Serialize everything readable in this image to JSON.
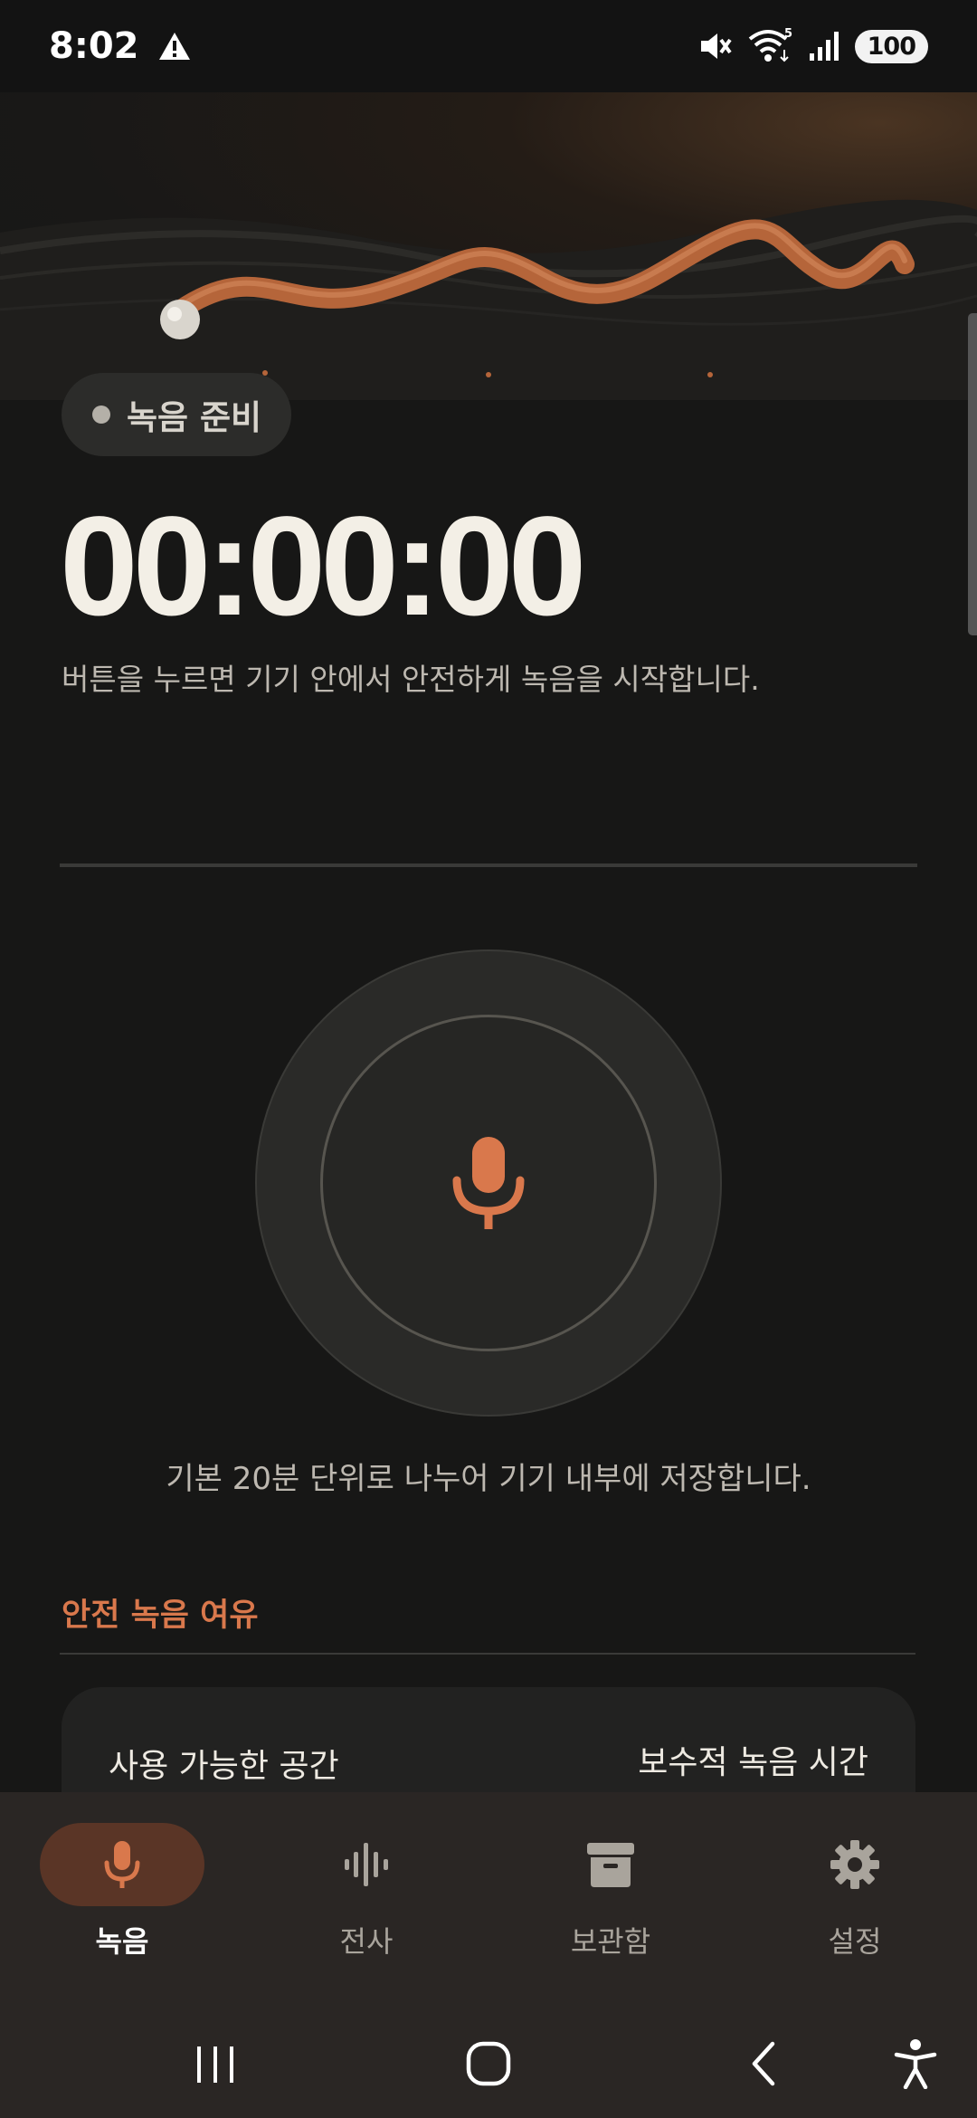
{
  "status_bar": {
    "time": "8:02",
    "battery": "100",
    "icons": [
      "alert-triangle-icon",
      "mute-icon",
      "wifi-icon",
      "signal-icon"
    ],
    "wifi_badge": "5"
  },
  "recorder": {
    "status_chip": "녹음 준비",
    "timer": "00:00:00",
    "subtitle": "버튼을 누르면 기기 안에서 안전하게 녹음을 시작합니다.",
    "caption": "기본 20분 단위로 나누어 기기 내부에 저장합니다."
  },
  "safety": {
    "section_title": "안전 녹음 여유",
    "available_space_label": "사용 가능한 공간",
    "conservative_time_label": "보수적 녹음 시간"
  },
  "nav": {
    "items": [
      {
        "label": "녹음",
        "icon": "microphone-icon",
        "active": true
      },
      {
        "label": "전사",
        "icon": "waveform-icon",
        "active": false
      },
      {
        "label": "보관함",
        "icon": "archive-box-icon",
        "active": false
      },
      {
        "label": "설정",
        "icon": "gear-icon",
        "active": false
      }
    ]
  },
  "system_nav": {
    "buttons": [
      "recents-icon",
      "home-icon",
      "back-icon",
      "accessibility-icon"
    ]
  },
  "colors": {
    "accent": "#D9784C",
    "background": "#171716",
    "nav_background": "#2A2624",
    "active_pill": "#5A3526"
  }
}
